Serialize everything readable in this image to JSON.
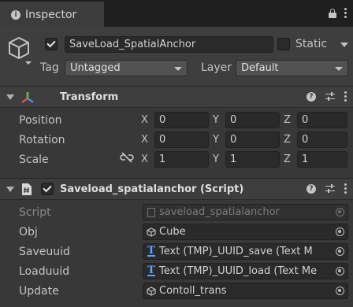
{
  "tab": {
    "label": "Inspector",
    "icon": "info-icon"
  },
  "gameobject": {
    "active": true,
    "name": "SaveLoad_SpatialAnchor",
    "static_label": "Static",
    "static_checked": false,
    "tag_label": "Tag",
    "tag_value": "Untagged",
    "layer_label": "Layer",
    "layer_value": "Default"
  },
  "transform": {
    "title": "Transform",
    "rows": [
      {
        "label": "Position",
        "x": "0",
        "y": "0",
        "z": "0"
      },
      {
        "label": "Rotation",
        "x": "0",
        "y": "0",
        "z": "0"
      },
      {
        "label": "Scale",
        "x": "1",
        "y": "1",
        "z": "1"
      }
    ],
    "axis_labels": {
      "x": "X",
      "y": "Y",
      "z": "Z"
    }
  },
  "script_component": {
    "title": "Saveload_spatialanchor (Script)",
    "enabled": true,
    "fields": [
      {
        "label": "Script",
        "value": "saveload_spatialanchor",
        "icon": "script-file-icon",
        "disabled": true
      },
      {
        "label": "Obj",
        "value": "Cube",
        "icon": "gameobject-icon",
        "disabled": false
      },
      {
        "label": "Saveuuid",
        "value": "Text (TMP)_UUID_save (Text M",
        "icon": "tmp-text-icon",
        "disabled": false
      },
      {
        "label": "Loaduuid",
        "value": "Text (TMP)_UUID_load (Text Me",
        "icon": "tmp-text-icon",
        "disabled": false
      },
      {
        "label": "Update",
        "value": "Contoll_trans",
        "icon": "gameobject-icon",
        "disabled": false
      }
    ]
  },
  "colors": {
    "background": "#383838",
    "header": "#3e3e3e",
    "field": "#2a2a2a",
    "text": "#c4c4c4",
    "tmp_blue": "#58a6ff",
    "axis_red": "#e05050",
    "axis_green": "#6cc04a",
    "axis_blue": "#4f8de0"
  }
}
